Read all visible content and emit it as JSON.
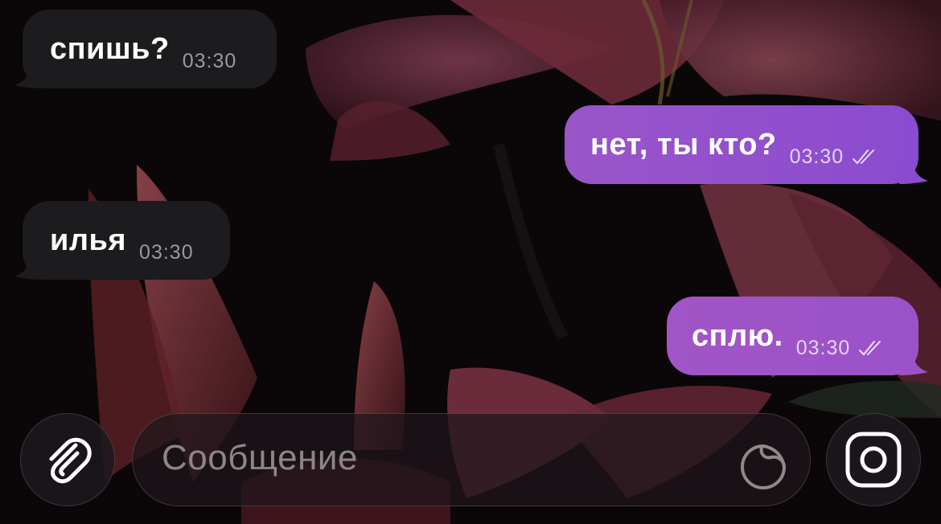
{
  "chat": {
    "messages": [
      {
        "direction": "incoming",
        "text": "спишь?",
        "time": "03:30"
      },
      {
        "direction": "outgoing",
        "text": "нет, ты кто?",
        "time": "03:30",
        "status": "read"
      },
      {
        "direction": "incoming",
        "text": "илья",
        "time": "03:30"
      },
      {
        "direction": "outgoing",
        "text": "сплю.",
        "time": "03:30",
        "status": "read"
      }
    ]
  },
  "composer": {
    "placeholder": "Сообщение",
    "attach_icon": "paperclip-icon",
    "sticker_icon": "sticker-icon",
    "camera_icon": "camera-icon"
  },
  "colors": {
    "incoming_bubble": "#1c1b1e",
    "outgoing_bubble": "#9a55c8",
    "background": "#0b0708"
  }
}
